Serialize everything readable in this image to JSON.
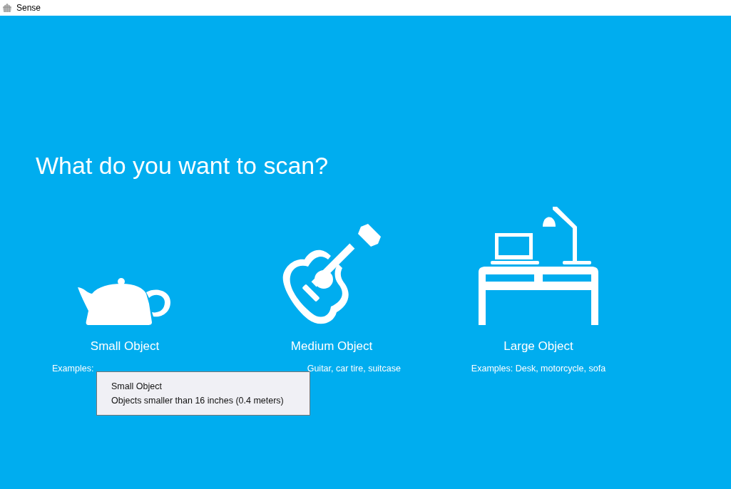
{
  "window": {
    "title": "Sense"
  },
  "heading": "What do you want to scan?",
  "options": [
    {
      "kind": "teapot",
      "label": "Small Object",
      "examples": "Examples:"
    },
    {
      "kind": "guitar",
      "label": "Medium Object",
      "examples": "Guitar, car tire, suitcase"
    },
    {
      "kind": "desk",
      "label": "Large Object",
      "examples": "Examples: Desk, motorcycle, sofa"
    }
  ],
  "tooltip": {
    "title": "Small Object",
    "text": "Objects smaller than 16 inches (0.4 meters)"
  }
}
